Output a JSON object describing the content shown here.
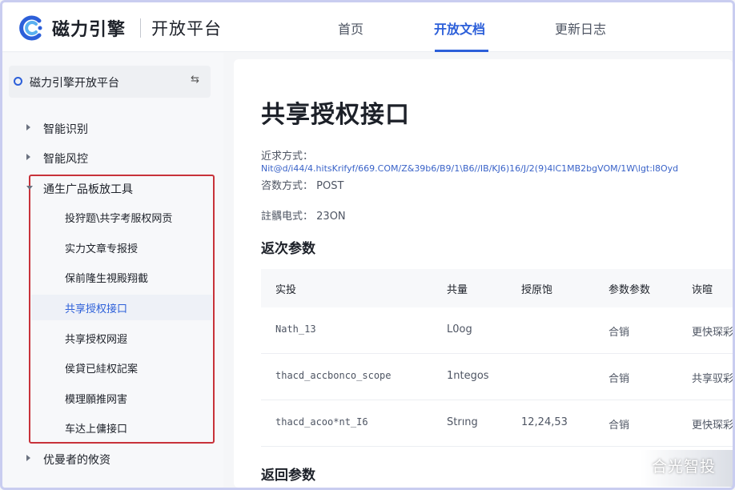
{
  "header": {
    "brand": "磁力引擎",
    "brand_sub": "开放平台",
    "nav": [
      "首页",
      "开放文档",
      "更新日志"
    ],
    "active_nav": "开放文档",
    "accent_color": "#2c5fd9"
  },
  "sidebar": {
    "root_label": "磁力引擎开放平台",
    "root_toggle_icon": "expand-collapse-icon",
    "items": [
      {
        "label": "智能识别"
      },
      {
        "label": "智能风控"
      }
    ],
    "group": {
      "label": "通生广品板放工具",
      "highlight_color": "#c8323a",
      "children": [
        {
          "label": "投狩题\\共字考服权网贡"
        },
        {
          "label": "实力文章专报授"
        },
        {
          "label": "保前隆生視殿翔截"
        },
        {
          "label": "共享授权接口",
          "active": true
        },
        {
          "label": "共享授权网遐"
        },
        {
          "label": "侯貸已絓权記案"
        },
        {
          "label": "模理願推网害"
        },
        {
          "label": "车达上傭接口"
        }
      ]
    },
    "after_items": [
      {
        "label": "优曼者的攸资"
      }
    ]
  },
  "main": {
    "title": "共享授权接口",
    "meta": [
      {
        "label": "近求方式：",
        "value": "Nit@d/i44/4.hitsKrifyf/669.COM/Z&39b6/B9/1\\B6//IB/KJ6)16/J/2(9)4lC1MB2bgVOM/1W\\lgt:l8Oyd"
      },
      {
        "label": "咨数方式：",
        "value": "POST"
      },
      {
        "label": "註髃电式：",
        "value": "23ON"
      }
    ],
    "section_params": "返次参数",
    "table": {
      "headers": [
        "实投",
        "共量",
        "授原饱",
        "参数参数",
        "诙暄"
      ],
      "rows": [
        [
          "Nath_13",
          "L0og",
          "",
          "合销",
          "更快琛彩"
        ],
        [
          "thacd_accbonco_scope",
          "1ntegos",
          "",
          "合销",
          "共享驭彩"
        ],
        [
          "thacd_acoo*nt_I6",
          "Strıng",
          "12,24,53",
          "合销",
          "更快琛彩"
        ]
      ]
    },
    "section_return": "返回参数"
  },
  "watermark": "合光智投"
}
